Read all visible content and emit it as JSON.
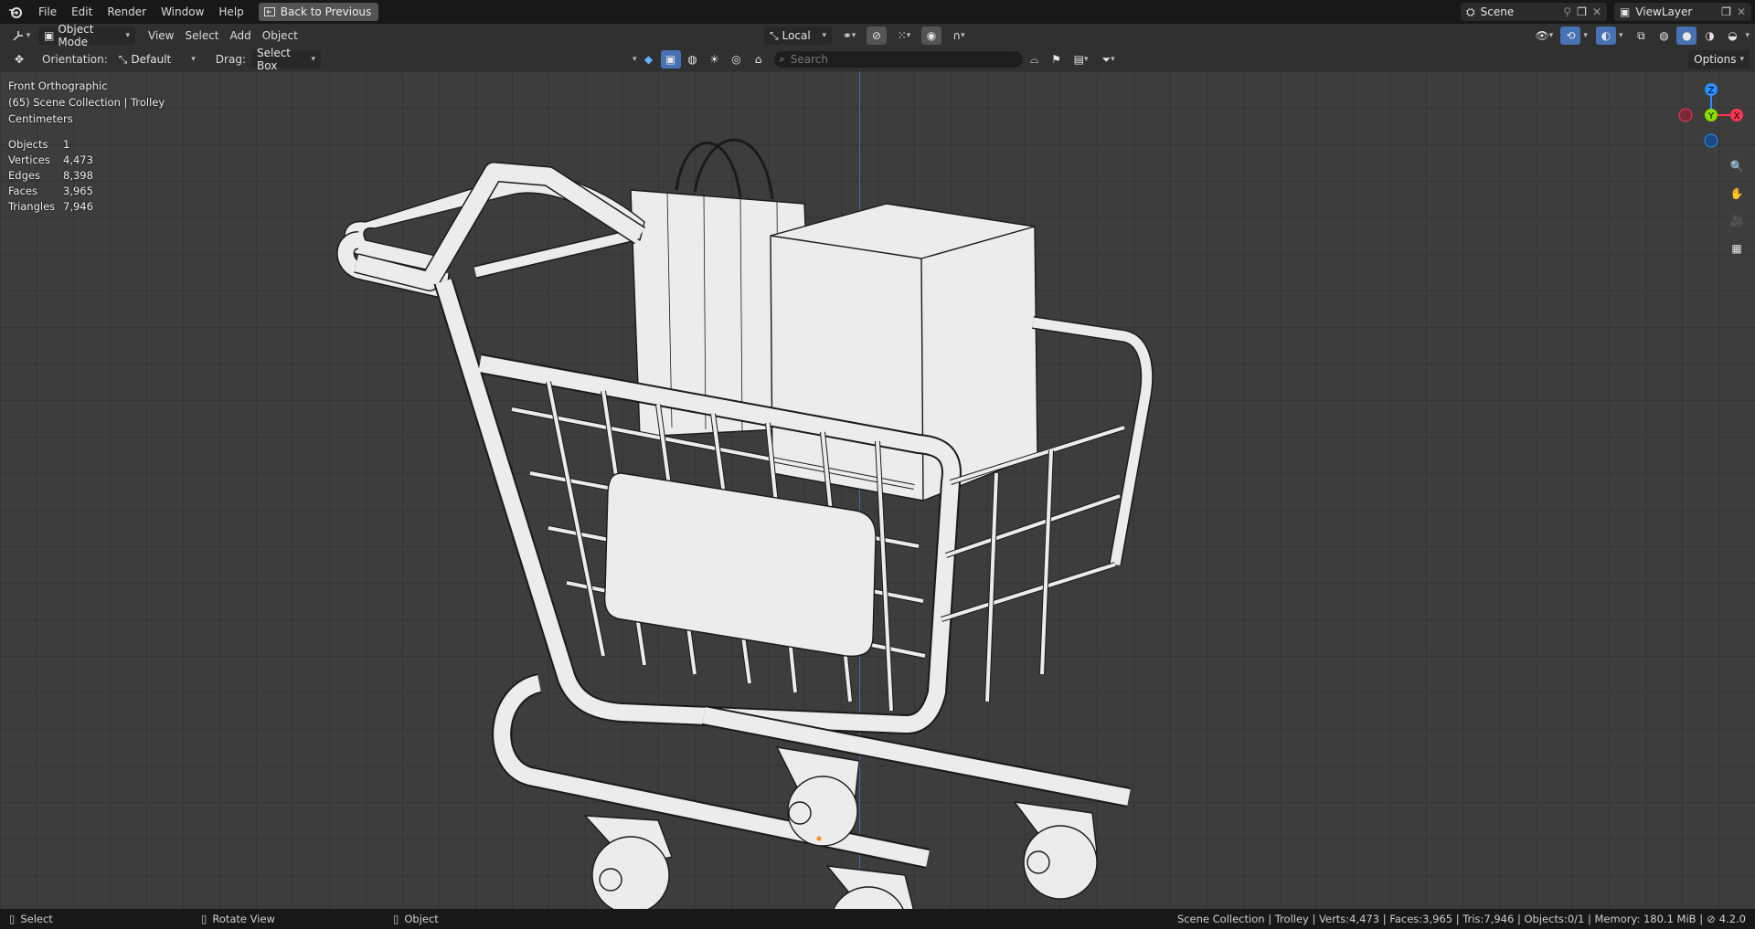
{
  "topbar": {
    "menus": [
      "File",
      "Edit",
      "Render",
      "Window",
      "Help"
    ],
    "back_label": "Back to Previous",
    "scene_name": "Scene",
    "view_layer": "ViewLayer"
  },
  "header": {
    "mode": "Object Mode",
    "menus": [
      "View",
      "Select",
      "Add",
      "Object"
    ],
    "transform_orientation": "Local",
    "options_label": "Options"
  },
  "toolhdr": {
    "orientation_label": "Orientation:",
    "orientation_value": "Default",
    "drag_label": "Drag:",
    "drag_value": "Select Box",
    "search_placeholder": "Search"
  },
  "viewport": {
    "view_name": "Front Orthographic",
    "collection_line": "(65) Scene Collection | Trolley",
    "units": "Centimeters",
    "stats": [
      {
        "k": "Objects",
        "v": "1"
      },
      {
        "k": "Vertices",
        "v": "4,473"
      },
      {
        "k": "Edges",
        "v": "8,398"
      },
      {
        "k": "Faces",
        "v": "3,965"
      },
      {
        "k": "Triangles",
        "v": "7,946"
      }
    ],
    "gizmo": {
      "z": "Z",
      "y": "Y",
      "x": "X"
    }
  },
  "statusbar": {
    "left": [
      {
        "icon": "mouse-left-icon",
        "label": "Select"
      },
      {
        "icon": "mouse-middle-icon",
        "label": "Rotate View"
      },
      {
        "icon": "mouse-right-icon",
        "label": "Object"
      }
    ],
    "right": "Scene Collection | Trolley | Verts:4,473 | Faces:3,965 | Tris:7,946 | Objects:0/1 | Memory: 180.1 MiB | ",
    "version": "4.2.0"
  },
  "colors": {
    "accent": "#4772b3",
    "axis_x": "#ff3352",
    "axis_y": "#8bdc00",
    "axis_z": "#2890ff",
    "grid_bg": "#3d3d3d"
  }
}
